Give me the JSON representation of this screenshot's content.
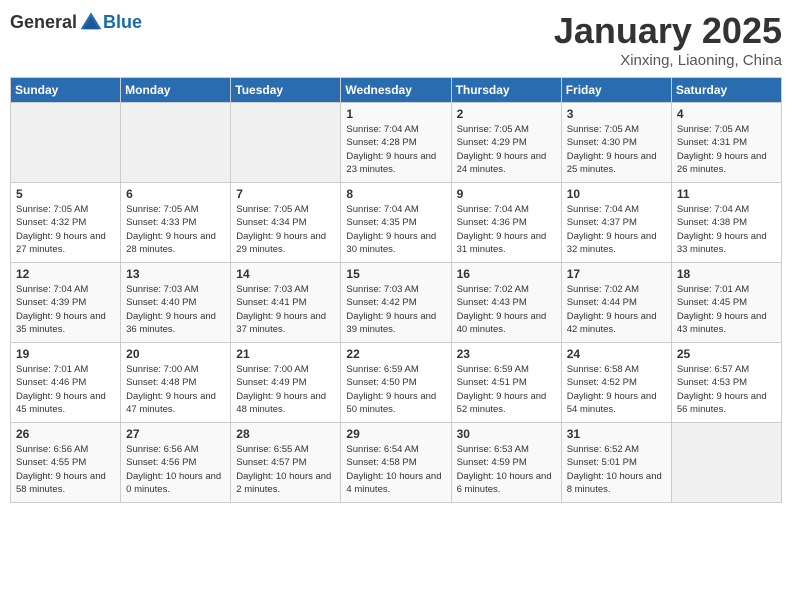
{
  "header": {
    "logo_general": "General",
    "logo_blue": "Blue",
    "month_title": "January 2025",
    "subtitle": "Xinxing, Liaoning, China"
  },
  "weekdays": [
    "Sunday",
    "Monday",
    "Tuesday",
    "Wednesday",
    "Thursday",
    "Friday",
    "Saturday"
  ],
  "weeks": [
    [
      {
        "day": "",
        "info": ""
      },
      {
        "day": "",
        "info": ""
      },
      {
        "day": "",
        "info": ""
      },
      {
        "day": "1",
        "info": "Sunrise: 7:04 AM\nSunset: 4:28 PM\nDaylight: 9 hours\nand 23 minutes."
      },
      {
        "day": "2",
        "info": "Sunrise: 7:05 AM\nSunset: 4:29 PM\nDaylight: 9 hours\nand 24 minutes."
      },
      {
        "day": "3",
        "info": "Sunrise: 7:05 AM\nSunset: 4:30 PM\nDaylight: 9 hours\nand 25 minutes."
      },
      {
        "day": "4",
        "info": "Sunrise: 7:05 AM\nSunset: 4:31 PM\nDaylight: 9 hours\nand 26 minutes."
      }
    ],
    [
      {
        "day": "5",
        "info": "Sunrise: 7:05 AM\nSunset: 4:32 PM\nDaylight: 9 hours\nand 27 minutes."
      },
      {
        "day": "6",
        "info": "Sunrise: 7:05 AM\nSunset: 4:33 PM\nDaylight: 9 hours\nand 28 minutes."
      },
      {
        "day": "7",
        "info": "Sunrise: 7:05 AM\nSunset: 4:34 PM\nDaylight: 9 hours\nand 29 minutes."
      },
      {
        "day": "8",
        "info": "Sunrise: 7:04 AM\nSunset: 4:35 PM\nDaylight: 9 hours\nand 30 minutes."
      },
      {
        "day": "9",
        "info": "Sunrise: 7:04 AM\nSunset: 4:36 PM\nDaylight: 9 hours\nand 31 minutes."
      },
      {
        "day": "10",
        "info": "Sunrise: 7:04 AM\nSunset: 4:37 PM\nDaylight: 9 hours\nand 32 minutes."
      },
      {
        "day": "11",
        "info": "Sunrise: 7:04 AM\nSunset: 4:38 PM\nDaylight: 9 hours\nand 33 minutes."
      }
    ],
    [
      {
        "day": "12",
        "info": "Sunrise: 7:04 AM\nSunset: 4:39 PM\nDaylight: 9 hours\nand 35 minutes."
      },
      {
        "day": "13",
        "info": "Sunrise: 7:03 AM\nSunset: 4:40 PM\nDaylight: 9 hours\nand 36 minutes."
      },
      {
        "day": "14",
        "info": "Sunrise: 7:03 AM\nSunset: 4:41 PM\nDaylight: 9 hours\nand 37 minutes."
      },
      {
        "day": "15",
        "info": "Sunrise: 7:03 AM\nSunset: 4:42 PM\nDaylight: 9 hours\nand 39 minutes."
      },
      {
        "day": "16",
        "info": "Sunrise: 7:02 AM\nSunset: 4:43 PM\nDaylight: 9 hours\nand 40 minutes."
      },
      {
        "day": "17",
        "info": "Sunrise: 7:02 AM\nSunset: 4:44 PM\nDaylight: 9 hours\nand 42 minutes."
      },
      {
        "day": "18",
        "info": "Sunrise: 7:01 AM\nSunset: 4:45 PM\nDaylight: 9 hours\nand 43 minutes."
      }
    ],
    [
      {
        "day": "19",
        "info": "Sunrise: 7:01 AM\nSunset: 4:46 PM\nDaylight: 9 hours\nand 45 minutes."
      },
      {
        "day": "20",
        "info": "Sunrise: 7:00 AM\nSunset: 4:48 PM\nDaylight: 9 hours\nand 47 minutes."
      },
      {
        "day": "21",
        "info": "Sunrise: 7:00 AM\nSunset: 4:49 PM\nDaylight: 9 hours\nand 48 minutes."
      },
      {
        "day": "22",
        "info": "Sunrise: 6:59 AM\nSunset: 4:50 PM\nDaylight: 9 hours\nand 50 minutes."
      },
      {
        "day": "23",
        "info": "Sunrise: 6:59 AM\nSunset: 4:51 PM\nDaylight: 9 hours\nand 52 minutes."
      },
      {
        "day": "24",
        "info": "Sunrise: 6:58 AM\nSunset: 4:52 PM\nDaylight: 9 hours\nand 54 minutes."
      },
      {
        "day": "25",
        "info": "Sunrise: 6:57 AM\nSunset: 4:53 PM\nDaylight: 9 hours\nand 56 minutes."
      }
    ],
    [
      {
        "day": "26",
        "info": "Sunrise: 6:56 AM\nSunset: 4:55 PM\nDaylight: 9 hours\nand 58 minutes."
      },
      {
        "day": "27",
        "info": "Sunrise: 6:56 AM\nSunset: 4:56 PM\nDaylight: 10 hours\nand 0 minutes."
      },
      {
        "day": "28",
        "info": "Sunrise: 6:55 AM\nSunset: 4:57 PM\nDaylight: 10 hours\nand 2 minutes."
      },
      {
        "day": "29",
        "info": "Sunrise: 6:54 AM\nSunset: 4:58 PM\nDaylight: 10 hours\nand 4 minutes."
      },
      {
        "day": "30",
        "info": "Sunrise: 6:53 AM\nSunset: 4:59 PM\nDaylight: 10 hours\nand 6 minutes."
      },
      {
        "day": "31",
        "info": "Sunrise: 6:52 AM\nSunset: 5:01 PM\nDaylight: 10 hours\nand 8 minutes."
      },
      {
        "day": "",
        "info": ""
      }
    ]
  ]
}
